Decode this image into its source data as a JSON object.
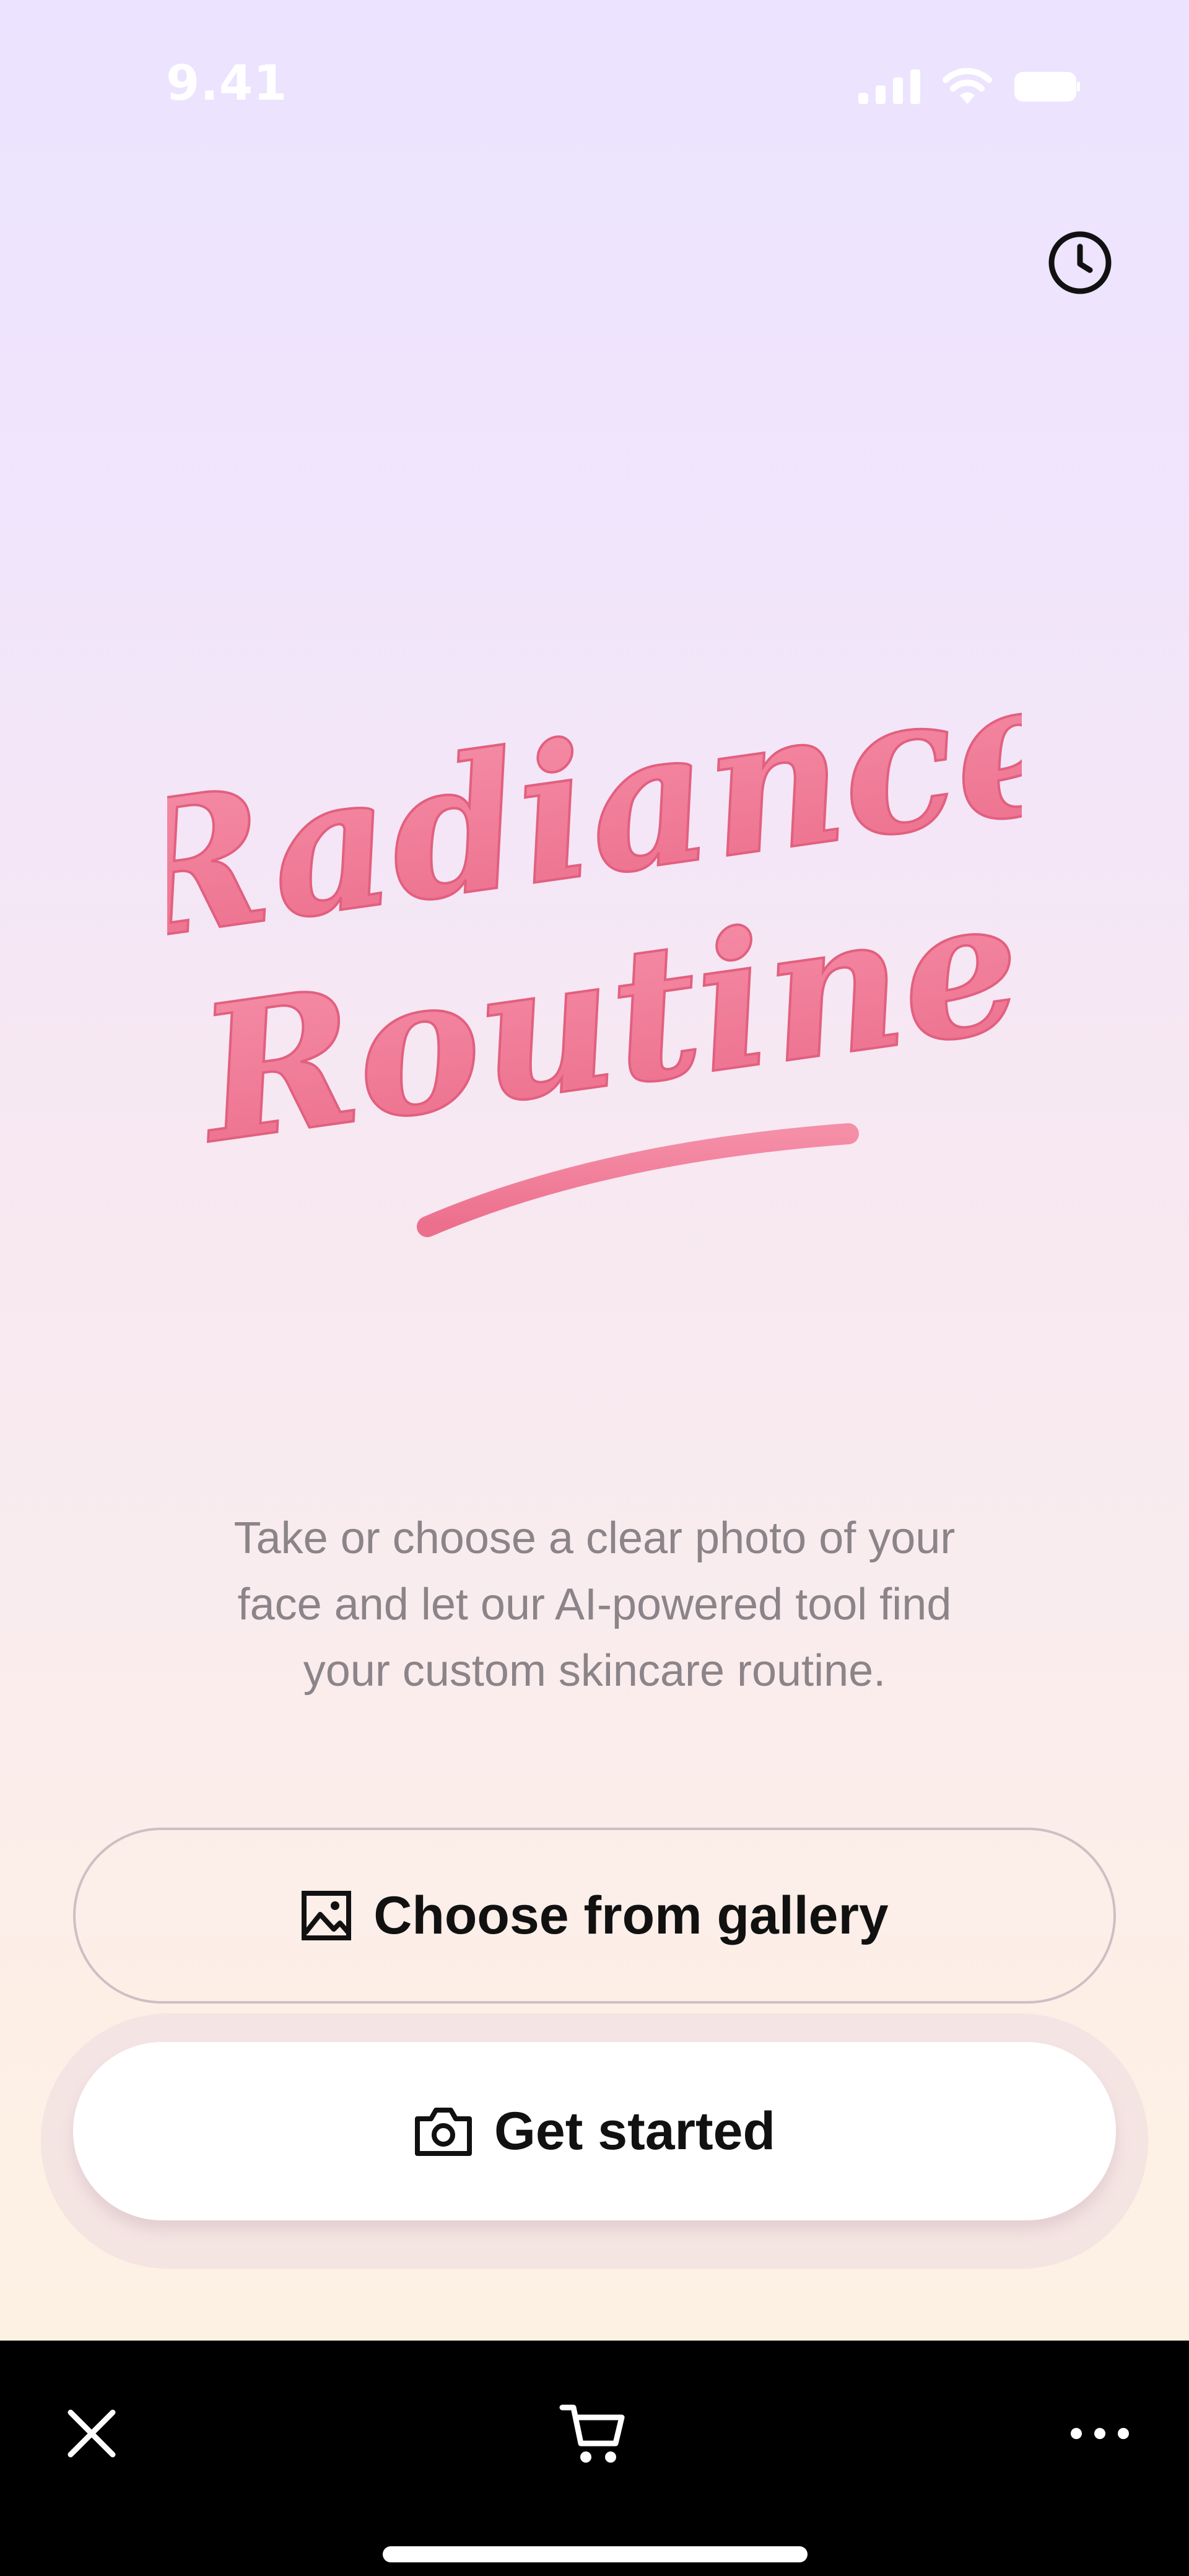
{
  "status_bar": {
    "time": "9.41",
    "icons": [
      "signal-icon",
      "wifi-icon",
      "battery-icon"
    ]
  },
  "header": {
    "history_icon": "clock-icon"
  },
  "logo": {
    "line1": "Radiance",
    "line2": "Routine",
    "color": "#f07a96"
  },
  "main": {
    "description_lines": [
      "Take or choose a clear photo of your",
      "face and let our AI-powered tool find",
      "your custom skincare routine."
    ],
    "gallery_button": {
      "label": "Choose from gallery",
      "icon": "image-icon"
    },
    "start_button": {
      "label": "Get started",
      "icon": "camera-icon"
    }
  },
  "toolbar": {
    "close_icon": "close-icon",
    "cart_icon": "cart-icon",
    "more_icon": "more-icon"
  }
}
